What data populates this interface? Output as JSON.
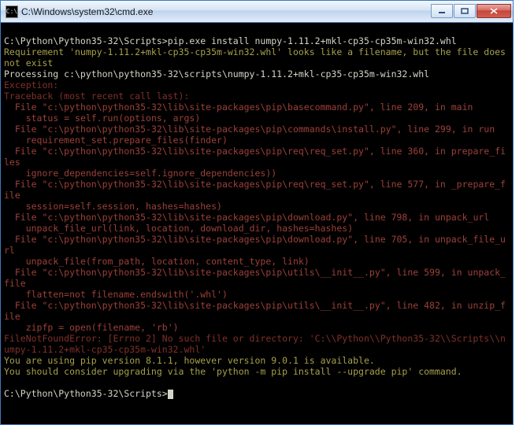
{
  "window": {
    "icon_text": "C:\\",
    "title": "C:\\Windows\\system32\\cmd.exe"
  },
  "terminal": {
    "prompt1": "C:\\Python\\Python35-32\\Scripts>",
    "command": "pip.exe install numpy-1.11.2+mkl-cp35-cp35m-win32.whl",
    "req_warn": "Requirement 'numpy-1.11.2+mkl-cp35-cp35m-win32.whl' looks like a filename, but the file does not exist",
    "processing": "Processing c:\\python\\python35-32\\scripts\\numpy-1.11.2+mkl-cp35-cp35m-win32.whl",
    "exception": "Exception:",
    "traceback": "Traceback (most recent call last):",
    "tb1": "  File \"c:\\python\\python35-32\\lib\\site-packages\\pip\\basecommand.py\", line 209, in main",
    "tb1b": "    status = self.run(options, args)",
    "tb2": "  File \"c:\\python\\python35-32\\lib\\site-packages\\pip\\commands\\install.py\", line 299, in run",
    "tb2b": "    requirement_set.prepare_files(finder)",
    "tb3": "  File \"c:\\python\\python35-32\\lib\\site-packages\\pip\\req\\req_set.py\", line 360, in prepare_files",
    "tb3b": "    ignore_dependencies=self.ignore_dependencies))",
    "tb4": "  File \"c:\\python\\python35-32\\lib\\site-packages\\pip\\req\\req_set.py\", line 577, in _prepare_file",
    "tb4b": "    session=self.session, hashes=hashes)",
    "tb5": "  File \"c:\\python\\python35-32\\lib\\site-packages\\pip\\download.py\", line 798, in unpack_url",
    "tb5b": "    unpack_file_url(link, location, download_dir, hashes=hashes)",
    "tb6": "  File \"c:\\python\\python35-32\\lib\\site-packages\\pip\\download.py\", line 705, in unpack_file_url",
    "tb6b": "    unpack_file(from_path, location, content_type, link)",
    "tb7": "  File \"c:\\python\\python35-32\\lib\\site-packages\\pip\\utils\\__init__.py\", line 599, in unpack_file",
    "tb7b": "    flatten=not filename.endswith('.whl')",
    "tb8": "  File \"c:\\python\\python35-32\\lib\\site-packages\\pip\\utils\\__init__.py\", line 482, in unzip_file",
    "tb8b": "    zipfp = open(filename, 'rb')",
    "fnf": "FileNotFoundError: [Errno 2] No such file or directory: 'C:\\\\Python\\\\Python35-32\\\\Scripts\\\\numpy-1.11.2+mkl-cp35-cp35m-win32.whl'",
    "pipver": "You are using pip version 8.1.1, however version 9.0.1 is available.",
    "pipup": "You should consider upgrading via the 'python -m pip install --upgrade pip' command.",
    "prompt2": "C:\\Python\\Python35-32\\Scripts>"
  }
}
